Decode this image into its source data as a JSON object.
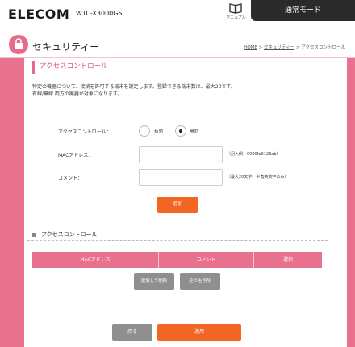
{
  "header": {
    "logo": "ELECOM",
    "model": "WTC-X3000GS",
    "manual_label": "マニュアル",
    "mode_button": "通常モード"
  },
  "title": {
    "text": "セキュリティー",
    "breadcrumb": {
      "home": "HOME",
      "sep1": " > ",
      "security": "セキュリティー",
      "sep2": " > ",
      "current": "アクセスコントロール"
    }
  },
  "section": {
    "heading": "アクセスコントロール",
    "desc_line1": "特定の機器について、接続を許可する端末を設定します。登録できる端末数は、最大20です。",
    "desc_line2": "有線/無線 両方の機器が対象になります。"
  },
  "form": {
    "access_label": "アクセスコントロール：",
    "opt_enabled": "有効",
    "opt_disabled": "無効",
    "selected": "無効",
    "mac_label": "MACアドレス：",
    "mac_value": "",
    "mac_hint": "（記入例：0090fe0123ab）",
    "comment_label": "コメント：",
    "comment_value": "",
    "comment_hint": "（最大20文字、半角英数字のみ）",
    "add_button": "追加"
  },
  "list": {
    "heading": "アクセスコントロール",
    "columns": [
      "MACアドレス",
      "コメント",
      "選択"
    ],
    "delete_selected": "選択して削除",
    "delete_all": "全てを削除"
  },
  "footer": {
    "back_button": "戻る",
    "apply_button": "適用"
  },
  "colors": {
    "accent_pink": "#e8718e",
    "accent_orange": "#f26522",
    "gray_button": "#8f8f8f",
    "mode_button": "#2a2a2a"
  }
}
